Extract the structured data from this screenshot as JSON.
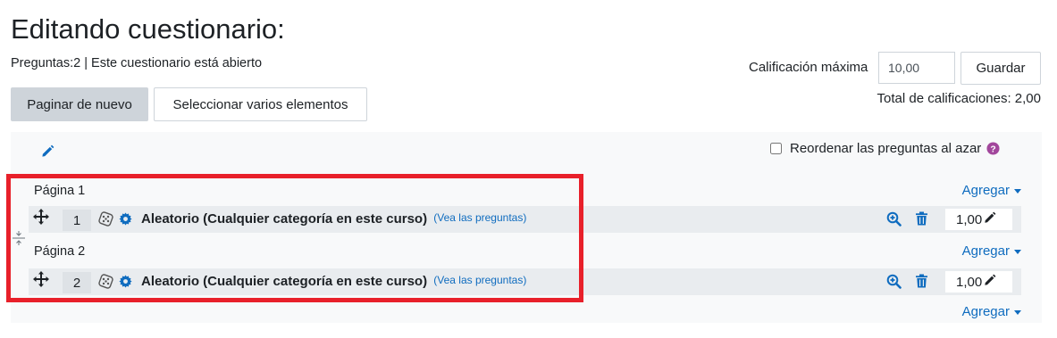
{
  "header": {
    "title": "Editando cuestionario:",
    "status": "Preguntas:2 | Este cuestionario está abierto"
  },
  "toolbar": {
    "repaginate_label": "Paginar de nuevo",
    "select_multiple_label": "Seleccionar varios elementos"
  },
  "grade": {
    "max_label": "Calificación máxima",
    "max_value": "10,00",
    "save_label": "Guardar",
    "total_label": "Total de calificaciones: 2,00"
  },
  "panel": {
    "shuffle_label": "Reordenar las preguntas al azar",
    "shuffle_checked": false
  },
  "add_label": "Agregar",
  "pages": [
    {
      "label": "Página 1",
      "question": {
        "slot": "1",
        "name": "Aleatorio (Cualquier categoría en este curso)",
        "link": "(Vea las preguntas)",
        "mark": "1,00"
      }
    },
    {
      "label": "Página 2",
      "question": {
        "slot": "2",
        "name": "Aleatorio (Cualquier categoría en este curso)",
        "link": "(Vea las preguntas)",
        "mark": "1,00"
      }
    }
  ],
  "colors": {
    "link": "#0f6cbf",
    "highlight": "#e8202a",
    "help": "#a2479c"
  },
  "icons": [
    "pencil-icon",
    "move-icon",
    "dice-icon",
    "gear-icon",
    "search-plus-icon",
    "trash-icon",
    "question-circle-icon",
    "page-break-icon"
  ]
}
